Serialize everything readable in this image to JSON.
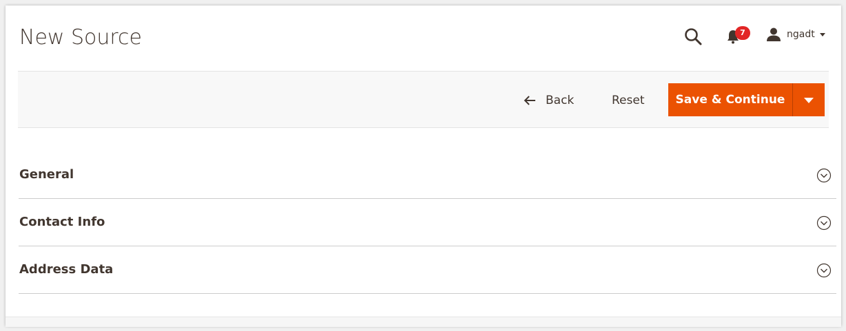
{
  "header": {
    "title": "New Source",
    "notifications": {
      "count": "7"
    },
    "user": {
      "name": "ngadt"
    }
  },
  "actions": {
    "back_label": "Back",
    "reset_label": "Reset",
    "save_label": "Save & Continue"
  },
  "sections": [
    {
      "title": "General"
    },
    {
      "title": "Contact Info"
    },
    {
      "title": "Address Data"
    }
  ],
  "colors": {
    "accent": "#eb5202",
    "badge": "#e22626",
    "text": "#41362f"
  }
}
